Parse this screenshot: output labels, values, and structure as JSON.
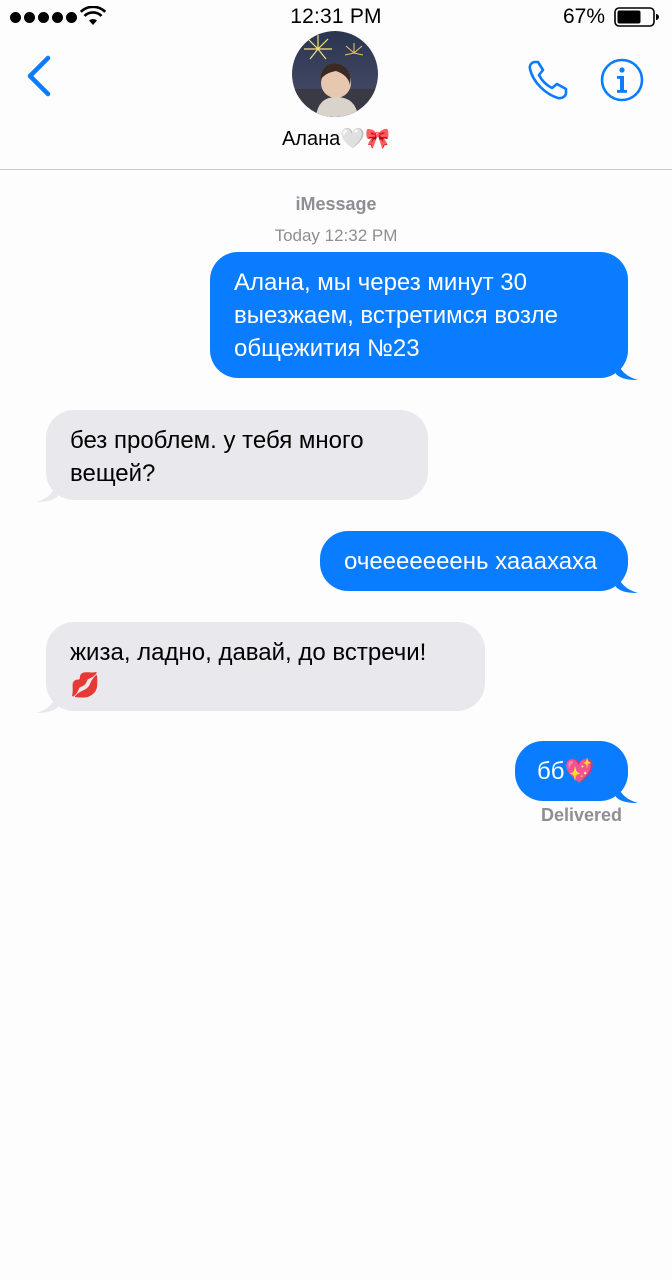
{
  "status_bar": {
    "time": "12:31 PM",
    "battery_percent": "67%",
    "signal_bars": 5,
    "wifi_icon": "wifi-icon",
    "battery_icon": "battery-icon"
  },
  "header": {
    "back_icon": "chevron-left-icon",
    "contact_name": "Алана🤍🎀",
    "phone_icon": "phone-icon",
    "info_icon": "info-icon",
    "accent_color": "#0a7cff"
  },
  "thread": {
    "service_label": "iMessage",
    "timestamp": "Today 12:32 PM",
    "delivered_label": "Delivered",
    "messages": [
      {
        "direction": "outgoing",
        "text": "Алана, мы через минут 30 выезжаем, встретимся возле общежития №23"
      },
      {
        "direction": "incoming",
        "text": "без проблем. у тебя много вещей?"
      },
      {
        "direction": "outgoing",
        "text": "очееееееень хааахаха"
      },
      {
        "direction": "incoming",
        "text": "жиза, ладно, давай, до встречи! 💋"
      },
      {
        "direction": "outgoing",
        "text": "бб💖"
      }
    ]
  },
  "colors": {
    "outgoing_bubble": "#0a7cff",
    "incoming_bubble": "#e8e8ed",
    "meta_text": "#8e8e93"
  }
}
